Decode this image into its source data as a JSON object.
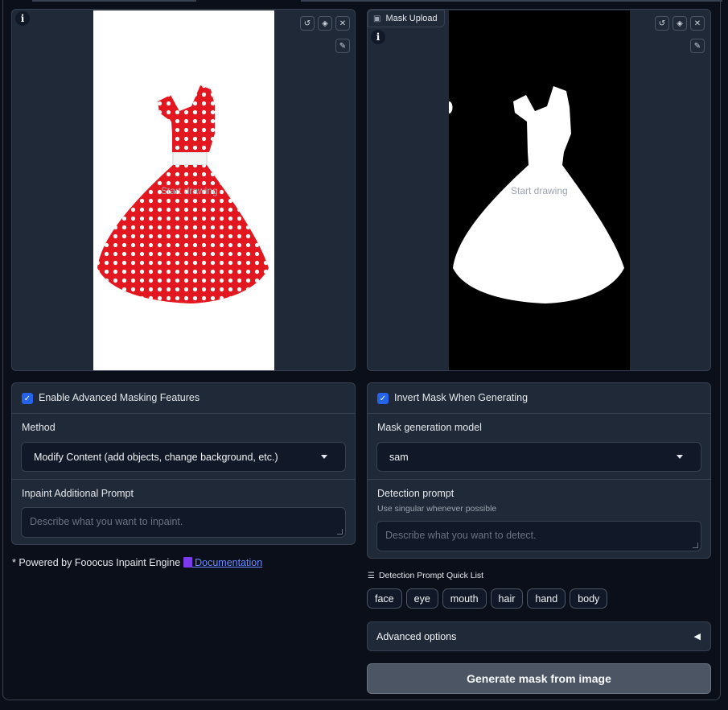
{
  "left_editor": {
    "hint": "Start drawing"
  },
  "right_editor": {
    "label": "Mask Upload",
    "hint": "Start drawing"
  },
  "left_settings": {
    "enable_label": "Enable Advanced Masking Features",
    "enable_checked": true,
    "method_label": "Method",
    "method_value": "Modify Content (add objects, change background, etc.)",
    "prompt_label": "Inpaint Additional Prompt",
    "prompt_placeholder": "Describe what you want to inpaint."
  },
  "footer_note": {
    "prefix": "* Powered by Fooocus Inpaint Engine ",
    "link": " Documentation"
  },
  "right_settings": {
    "invert_label": "Invert Mask When Generating",
    "invert_checked": true,
    "model_label": "Mask generation model",
    "model_value": "sam",
    "detect_label": "Detection prompt",
    "detect_hint": "Use singular whenever possible",
    "detect_placeholder": "Describe what you want to detect."
  },
  "quick_list": {
    "title": "Detection Prompt Quick List",
    "items": [
      "face",
      "eye",
      "mouth",
      "hair",
      "hand",
      "body"
    ]
  },
  "advanced": {
    "label": "Advanced options"
  },
  "generate": {
    "label": "Generate mask from image"
  },
  "colors": {
    "accent": "#2563eb",
    "link": "#6b8cff",
    "dress_red": "#e3171f"
  }
}
